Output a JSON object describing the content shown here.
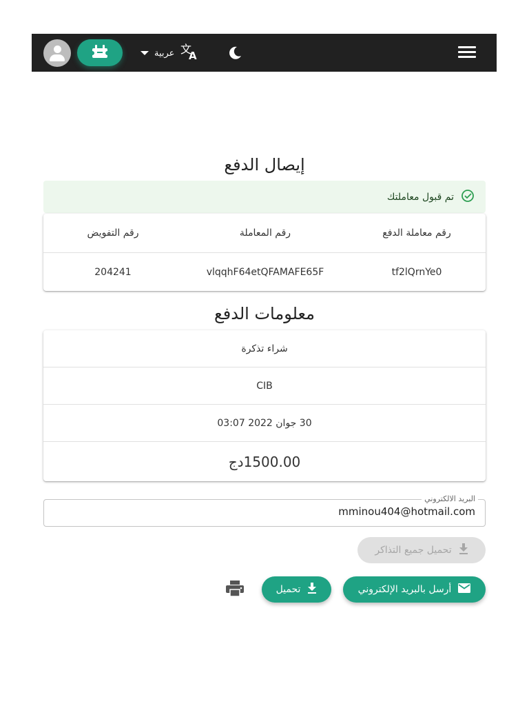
{
  "colors": {
    "accent": "#1fa384",
    "topbar": "#212121",
    "success_bg": "#edf7ed"
  },
  "topbar": {
    "language_label": "عربية",
    "icons": [
      "avatar-icon",
      "ticket-icon",
      "dropdown-caret-icon",
      "translate-icon",
      "moon-icon",
      "menu-icon"
    ]
  },
  "receipt": {
    "title": "إيصال الدفع",
    "success_message": "تم قبول معاملتك",
    "table": {
      "headers": [
        "رقم معاملة الدفع",
        "رقم المعاملة",
        "رقم التفويض"
      ],
      "row": [
        "tf2lQrnYe0",
        "vlqqhF64etQFAMAFE65F",
        "204241"
      ]
    }
  },
  "payment_info": {
    "title": "معلومات الدفع",
    "purpose": "شراء تذكرة",
    "method": "CIB",
    "date": "30 جوان 2022 03:07",
    "amount": "1500.00دج"
  },
  "email": {
    "label": "البريد الالكتروني",
    "value": "mminou404@hotmail.com"
  },
  "actions": {
    "download_all": "تحميل جميع التذاكر",
    "send_email": "أرسل بالبريد الإلكتروني",
    "download": "تحميل"
  }
}
